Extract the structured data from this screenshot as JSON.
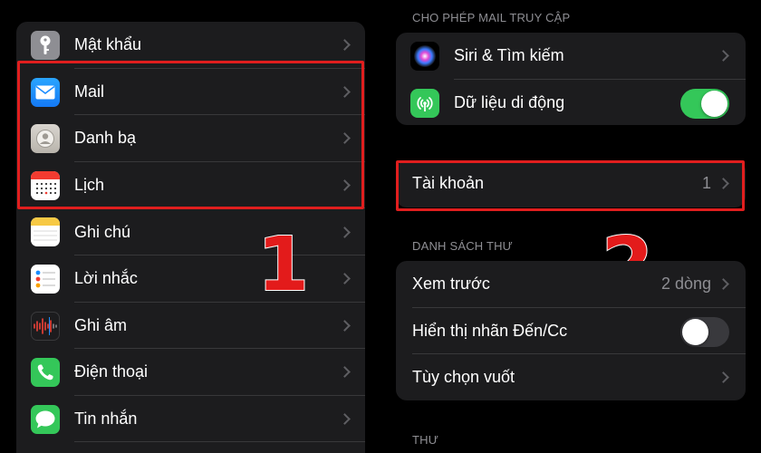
{
  "left_list": {
    "items": [
      {
        "label": "Mật khẩu",
        "icon": "key-icon",
        "color": "#8e8e93"
      },
      {
        "label": "Mail",
        "icon": "mail-icon",
        "color": "#1a8cff"
      },
      {
        "label": "Danh bạ",
        "icon": "contacts-icon",
        "color": "#c8c4bd"
      },
      {
        "label": "Lịch",
        "icon": "calendar-icon",
        "color": "#ffffff"
      },
      {
        "label": "Ghi chú",
        "icon": "notes-icon",
        "color": "#ffffff"
      },
      {
        "label": "Lời nhắc",
        "icon": "reminders-icon",
        "color": "#ffffff"
      },
      {
        "label": "Ghi âm",
        "icon": "voice-memos-icon",
        "color": "#1c1c1e"
      },
      {
        "label": "Điện thoại",
        "icon": "phone-icon",
        "color": "#34c759"
      },
      {
        "label": "Tin nhắn",
        "icon": "messages-icon",
        "color": "#34c759"
      }
    ]
  },
  "right": {
    "allow_header": "CHO PHÉP MAIL TRUY CẬP",
    "allow_items": [
      {
        "label": "Siri & Tìm kiếm",
        "icon": "siri-icon"
      },
      {
        "label": "Dữ liệu di động",
        "icon": "cellular-icon",
        "toggle": "on"
      }
    ],
    "accounts": {
      "label": "Tài khoản",
      "value": "1"
    },
    "list_header": "DANH SÁCH THƯ",
    "list_items": [
      {
        "label": "Xem trước",
        "value": "2 dòng"
      },
      {
        "label": "Hiển thị nhãn Đến/Cc",
        "toggle": "off"
      },
      {
        "label": "Tùy chọn vuốt"
      }
    ],
    "mail_header": "THƯ"
  },
  "annotations": {
    "one": "1",
    "two": "2"
  },
  "colors": {
    "highlight": "#e01e1e",
    "toggle_on": "#34c759",
    "background": "#000000",
    "cell": "#1c1c1e"
  }
}
